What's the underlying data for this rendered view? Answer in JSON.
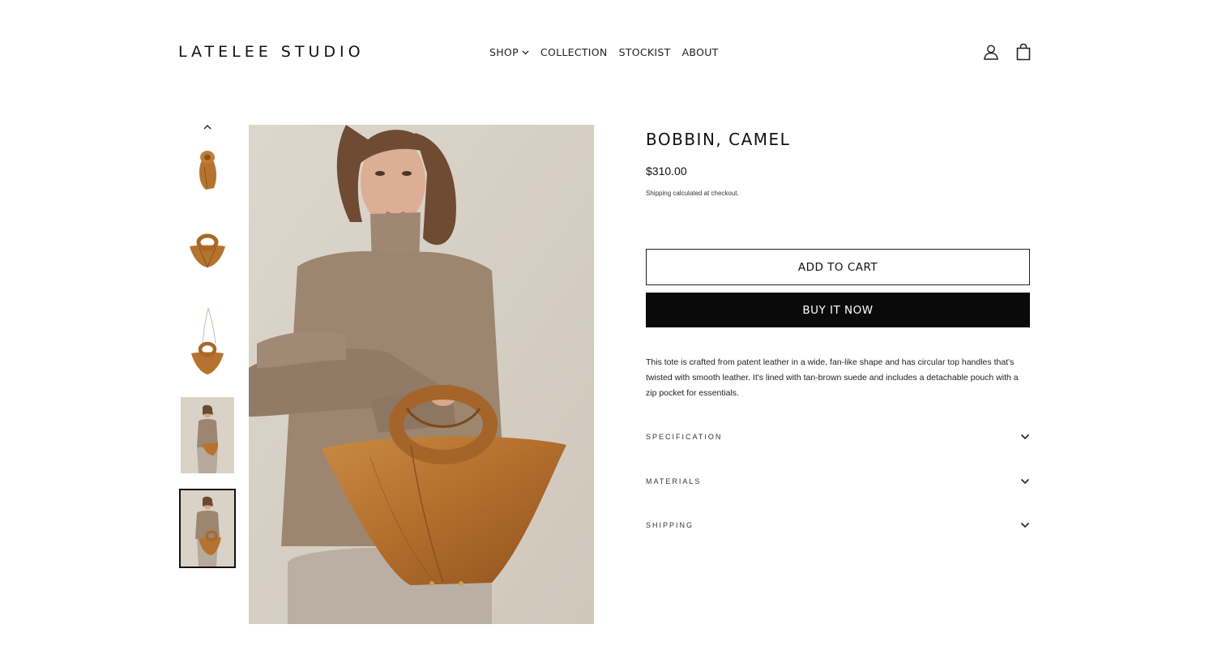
{
  "brand": {
    "name": "LATELEE STUDIO"
  },
  "nav": {
    "items": [
      {
        "label": "SHOP",
        "has_dropdown": true
      },
      {
        "label": "COLLECTION"
      },
      {
        "label": "STOCKIST"
      },
      {
        "label": "ABOUT"
      }
    ]
  },
  "header_icons": [
    "account-icon",
    "cart-icon"
  ],
  "gallery": {
    "thumbnails": [
      "thumbnail-bag-side",
      "thumbnail-bag-front",
      "thumbnail-bag-strap",
      "thumbnail-model",
      "thumbnail-model-selected"
    ],
    "selected_index": 4
  },
  "product": {
    "title": "BOBBIN, CAMEL",
    "price": "$310.00",
    "shipping_note": "Shipping calculated at checkout.",
    "add_to_cart_label": "ADD TO CART",
    "buy_now_label": "BUY IT NOW",
    "description": "This tote is crafted from patent leather in a wide, fan-like shape and has circular top handles that's twisted with smooth leather. It's lined with tan-brown suede and includes a detachable pouch with a zip pocket for essentials.",
    "accordions": [
      {
        "label": "SPECIFICATION"
      },
      {
        "label": "MATERIALS"
      },
      {
        "label": "SHIPPING"
      }
    ]
  },
  "colors": {
    "bag_camel": "#b5732f",
    "backdrop": "#d8d1c6",
    "sweater": "#9c8670",
    "buy_button": "#0a0a0a"
  }
}
